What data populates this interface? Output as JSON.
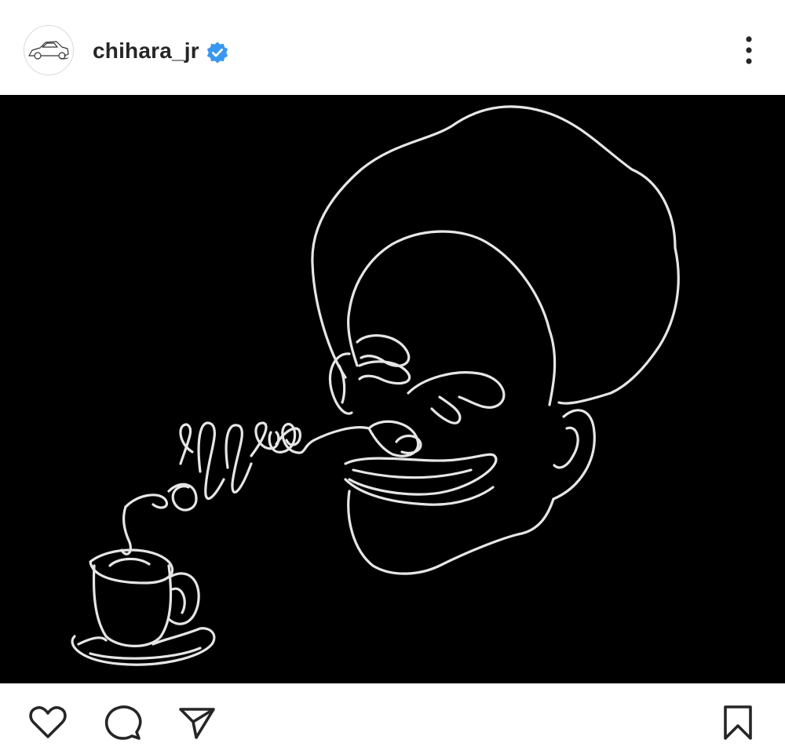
{
  "post": {
    "username": "chihara_jr",
    "verified": true,
    "avatar_icon": "car-sketch-avatar",
    "more_icon": "more-vertical-icon",
    "image": {
      "description_icon": "line-drawing-face-coffee",
      "background_color": "#000000",
      "stroke_color": "#e8e8e8"
    }
  },
  "actions": {
    "like_icon": "heart-icon",
    "comment_icon": "comment-icon",
    "share_icon": "send-icon",
    "save_icon": "bookmark-icon"
  },
  "colors": {
    "text": "#262626",
    "verified_blue": "#3897f0",
    "border": "#dbdbdb"
  }
}
